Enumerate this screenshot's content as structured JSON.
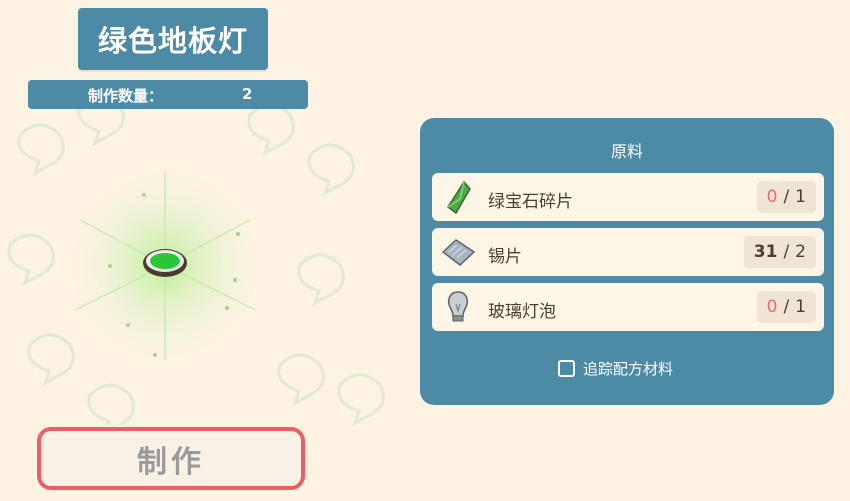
{
  "item": {
    "title": "绿色地板灯"
  },
  "quantity": {
    "label": "制作数量：",
    "value": "2"
  },
  "craft_button": {
    "label": "制作"
  },
  "materials": {
    "title": "原料",
    "rows": [
      {
        "name": "绿宝石碎片",
        "have": "0",
        "need": "1",
        "icon": "emerald-shard-icon"
      },
      {
        "name": "锡片",
        "have": "31",
        "need": "2",
        "icon": "tin-sheet-icon"
      },
      {
        "name": "玻璃灯泡",
        "have": "0",
        "need": "1",
        "icon": "glass-bulb-icon"
      }
    ],
    "separator": "/"
  },
  "track_recipe": {
    "label": "追踪配方材料",
    "checked": false
  },
  "colors": {
    "panel": "#4d8aa6",
    "craft_border": "#ec5f66",
    "missing": "#ec6b6b",
    "background": "#fdf3e2"
  }
}
